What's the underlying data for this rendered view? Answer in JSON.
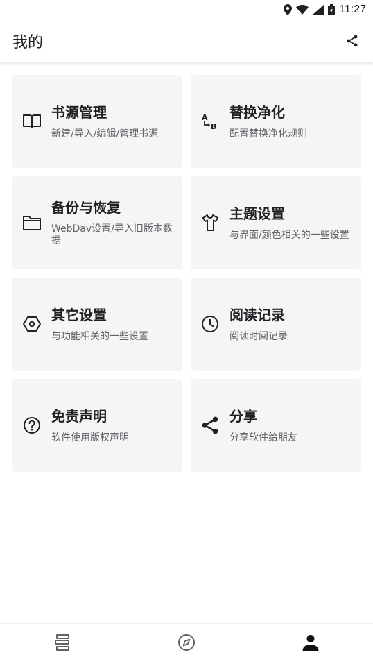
{
  "status_bar": {
    "time": "11:27",
    "icons": [
      "location-icon",
      "wifi-icon",
      "signal-icon",
      "battery-icon"
    ]
  },
  "app_bar": {
    "title": "我的",
    "action_icon": "share-icon"
  },
  "cards": [
    {
      "title": "书源管理",
      "subtitle": "新建/导入/编辑/管理书源",
      "icon": "book-icon"
    },
    {
      "title": "替换净化",
      "subtitle": "配置替换净化规则",
      "icon": "replace-ab-icon"
    },
    {
      "title": "备份与恢复",
      "subtitle": "WebDav设置/导入旧版本数据",
      "icon": "folder-icon"
    },
    {
      "title": "主题设置",
      "subtitle": "与界面/颜色相关的一些设置",
      "icon": "tshirt-icon"
    },
    {
      "title": "其它设置",
      "subtitle": "与功能相关的一些设置",
      "icon": "hexagon-settings-icon"
    },
    {
      "title": "阅读记录",
      "subtitle": "阅读时间记录",
      "icon": "clock-icon"
    },
    {
      "title": "免责声明",
      "subtitle": "软件使用版权声明",
      "icon": "help-circle-icon"
    },
    {
      "title": "分享",
      "subtitle": "分享软件给朋友",
      "icon": "share-icon"
    }
  ],
  "bottom_nav": {
    "tabs": [
      {
        "icon": "bookshelf-icon",
        "active": false
      },
      {
        "icon": "compass-icon",
        "active": false
      },
      {
        "icon": "person-icon",
        "active": true
      }
    ]
  }
}
